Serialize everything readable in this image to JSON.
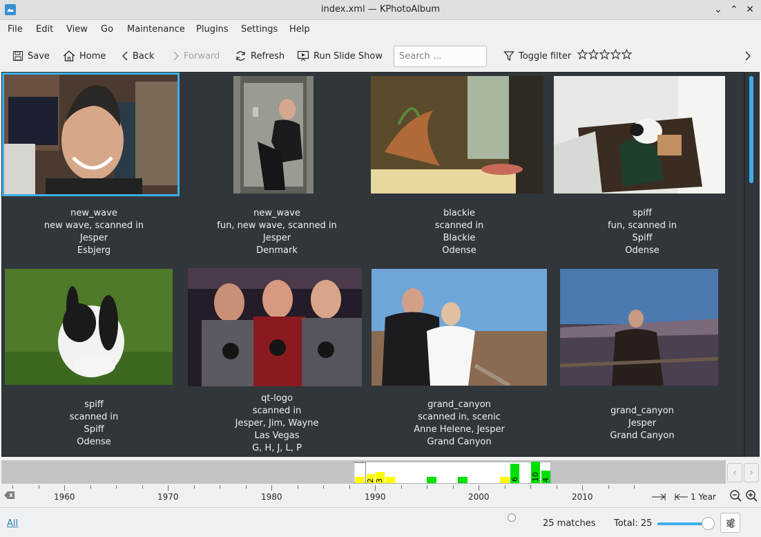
{
  "window": {
    "title": "index.xml — KPhotoAlbum"
  },
  "menu": [
    "File",
    "Edit",
    "View",
    "Go",
    "Maintenance",
    "Plugins",
    "Settings",
    "Help"
  ],
  "toolbar": {
    "save": "Save",
    "home": "Home",
    "back": "Back",
    "forward": "Forward",
    "refresh": "Refresh",
    "slideshow": "Run Slide Show",
    "search_placeholder": "Search ...",
    "toggle_filter": "Toggle filter",
    "rating_stars": 0
  },
  "thumbnails": [
    {
      "lines": [
        "new_wave",
        "new wave, scanned in",
        "Jesper",
        "Esbjerg"
      ]
    },
    {
      "lines": [
        "new_wave",
        "fun, new wave, scanned in",
        "Jesper",
        "Denmark"
      ]
    },
    {
      "lines": [
        "blackie",
        "scanned in",
        "Blackie",
        "Odense"
      ]
    },
    {
      "lines": [
        "spiff",
        "fun, scanned in",
        "Spiff",
        "Odense"
      ]
    },
    {
      "lines": [
        "spiff",
        "scanned in",
        "Spiff",
        "Odense"
      ]
    },
    {
      "lines": [
        "qt-logo",
        "scanned in",
        "Jesper, Jim, Wayne",
        "Las Vegas",
        "G, H, J, L, P"
      ]
    },
    {
      "lines": [
        "grand_canyon",
        "scanned in, scenic",
        "Anne Helene, Jesper",
        "Grand Canyon"
      ]
    },
    {
      "lines": [
        "grand_canyon",
        "Jesper",
        "Grand Canyon"
      ]
    }
  ],
  "timeline": {
    "years": [
      "1960",
      "1970",
      "1980",
      "1990",
      "2000",
      "2010"
    ],
    "bar_labels": [
      "2",
      "3",
      "6",
      "10",
      "4"
    ],
    "colors": {
      "yellow": "#ffff00",
      "green": "#00e000"
    },
    "unit": "1 Year"
  },
  "status": {
    "all_link": "All",
    "matches": "25 matches",
    "total": "Total: 25"
  },
  "colors": {
    "accent": "#3daee9",
    "thumb_bg": "#31363b"
  }
}
